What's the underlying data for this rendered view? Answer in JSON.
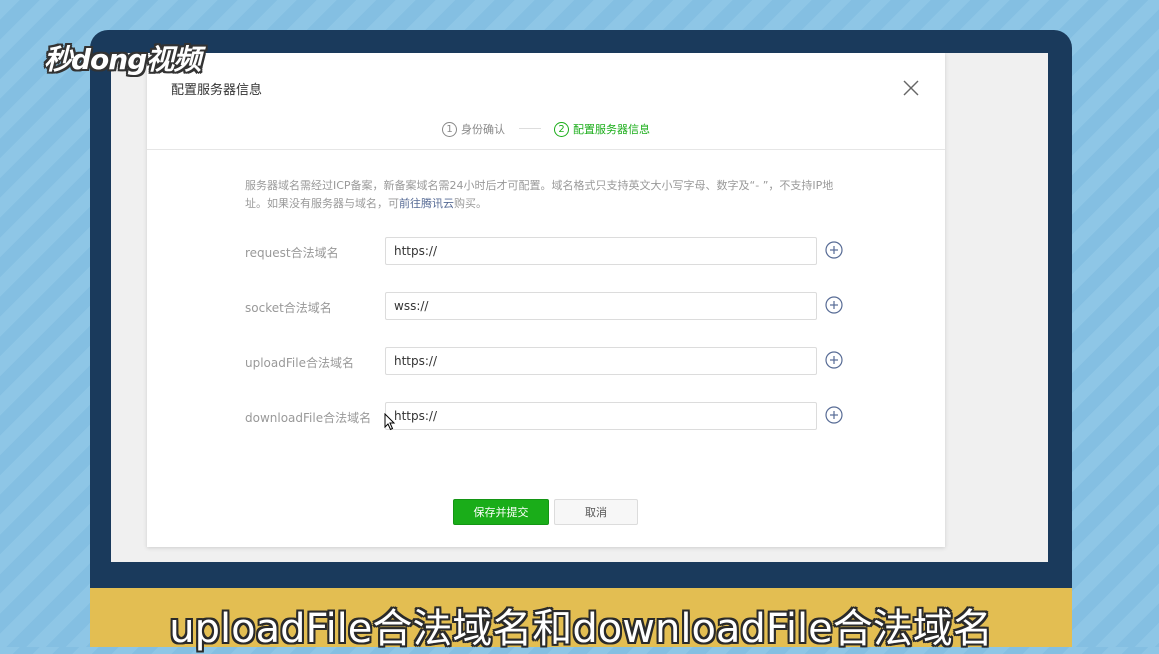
{
  "watermark": {
    "logo_text": "秒dong视频"
  },
  "modal": {
    "title": "配置服务器信息",
    "steps": [
      {
        "num": "1",
        "label": "身份确认",
        "active": false
      },
      {
        "num": "2",
        "label": "配置服务器信息",
        "active": true
      }
    ],
    "notice_part1": "服务器域名需经过ICP备案，新备案域名需24小时后才可配置。域名格式只支持英文大小写字母、数字及“- ”，不支持IP地址。如果没有服务器与域名，可",
    "notice_link": "前往腾讯云",
    "notice_part2": "购买。",
    "fields": [
      {
        "label": "request合法域名",
        "value": "https://"
      },
      {
        "label": "socket合法域名",
        "value": "wss://"
      },
      {
        "label": "uploadFile合法域名",
        "value": "https://"
      },
      {
        "label": "downloadFile合法域名",
        "value": "https://"
      }
    ],
    "submit_label": "保存并提交",
    "cancel_label": "取消"
  },
  "subtitle": "uploadFile合法域名和downloadFile合法域名",
  "colors": {
    "accent_green": "#1aad19",
    "link_blue": "#576b95",
    "subtitle_bg": "#e3be52",
    "device_frame": "#1a3a5c"
  }
}
